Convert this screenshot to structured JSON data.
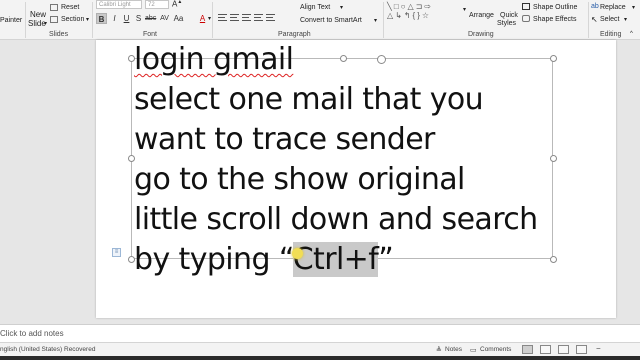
{
  "ribbon": {
    "left_partial": "Painter",
    "slides_group": {
      "new_slide": "New",
      "new_slide_2": "Slide",
      "reset": "Reset",
      "section": "Section",
      "label": "Slides"
    },
    "font_group": {
      "font_name": "Calibri Light (...)",
      "font_size": "72",
      "label": "Font"
    },
    "paragraph_group": {
      "align_text": "Align Text",
      "convert_smartart": "Convert to SmartArt",
      "label": "Paragraph"
    },
    "drawing_group": {
      "arrange": "Arrange",
      "quick_styles": "Quick",
      "quick_styles_2": "Styles",
      "shape_outline": "Shape Outline",
      "shape_effects": "Shape Effects",
      "label": "Drawing"
    },
    "editing_group": {
      "replace": "Replace",
      "select": "Select",
      "label": "Editing"
    }
  },
  "slide": {
    "lines": [
      "login gmail",
      "select one mail that you",
      "want to trace sender",
      "go to the show original",
      "little scroll down and search"
    ],
    "last_line_prefix": "by typing “",
    "last_line_highlight": "Ctrl+f",
    "last_line_suffix": "”"
  },
  "notes": {
    "placeholder": "Click to add notes"
  },
  "status": {
    "language": "nglish (United States)",
    "recovered": "Recovered",
    "notes": "Notes",
    "comments": "Comments"
  }
}
